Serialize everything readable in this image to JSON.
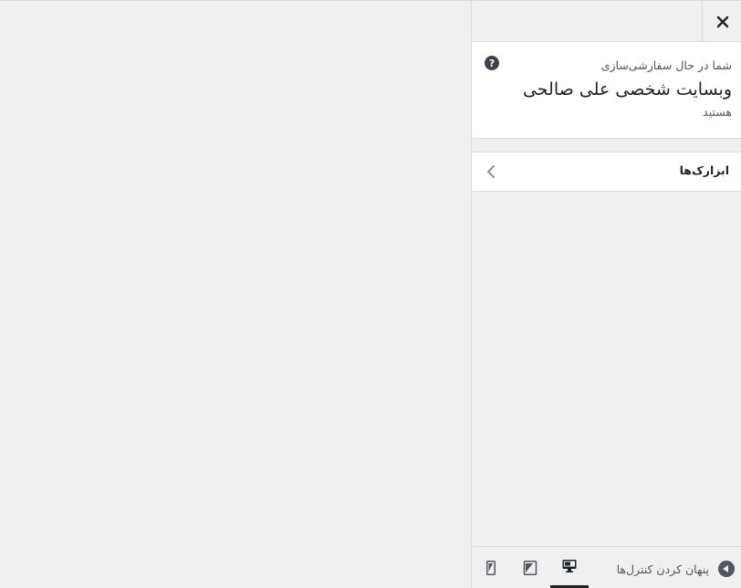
{
  "customizer": {
    "close_label": "×",
    "info": {
      "pre_text": "شما در حال سفارشی‌سازی",
      "site_title": "وبسایت شخصی علی صالحی",
      "post_text": "هستید",
      "help_symbol": "?"
    },
    "sections": [
      {
        "label": "ابزارک‌ها",
        "icon": "chevron-left-icon"
      }
    ],
    "footer": {
      "hide_controls_label": "پنهان کردن کنترل‌ها",
      "devices": [
        {
          "name": "desktop",
          "icon": "desktop-icon",
          "active": true
        },
        {
          "name": "tablet",
          "icon": "tablet-icon",
          "active": false
        },
        {
          "name": "mobile",
          "icon": "mobile-icon",
          "active": false
        }
      ]
    }
  }
}
